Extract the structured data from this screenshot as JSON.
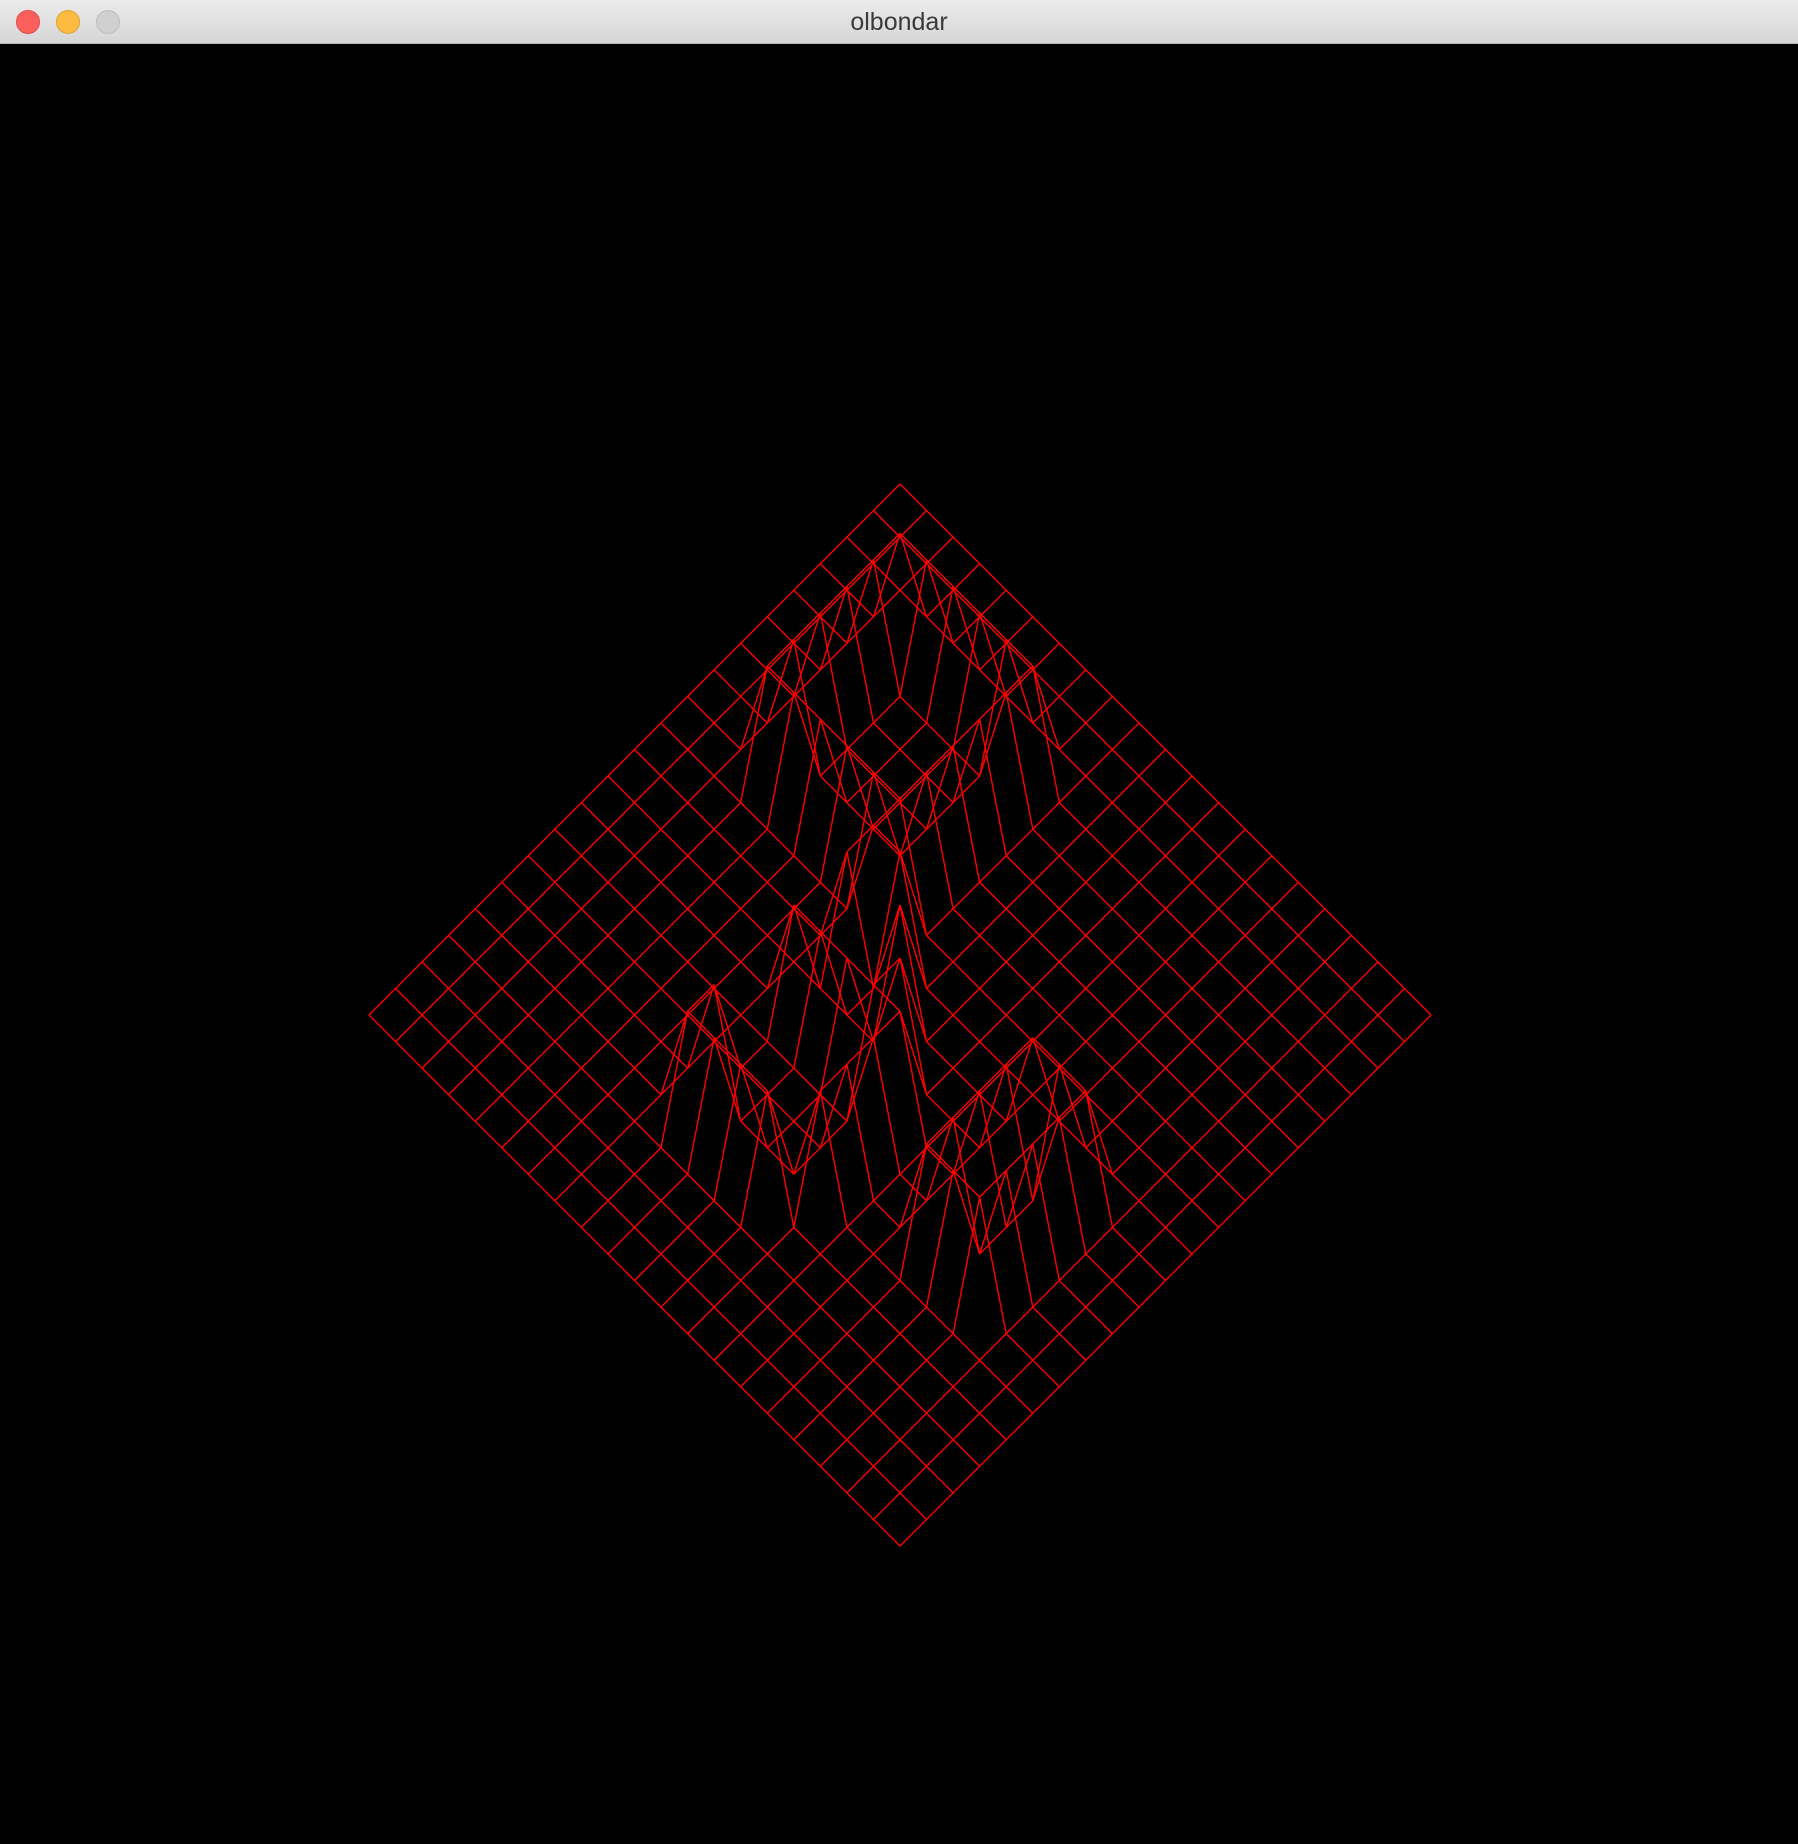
{
  "window": {
    "title": "olbondar",
    "background_color": "#000000"
  },
  "titlebar": {
    "buttons": [
      {
        "name": "close",
        "color": "#fc605c"
      },
      {
        "name": "minimize",
        "color": "#fdbc40"
      },
      {
        "name": "zoom",
        "color": "#d0d0d0"
      }
    ]
  },
  "wireframe": {
    "color": "#ff0000",
    "grid_size": 20,
    "description_type": "isometric-heightmap-wireframe"
  }
}
